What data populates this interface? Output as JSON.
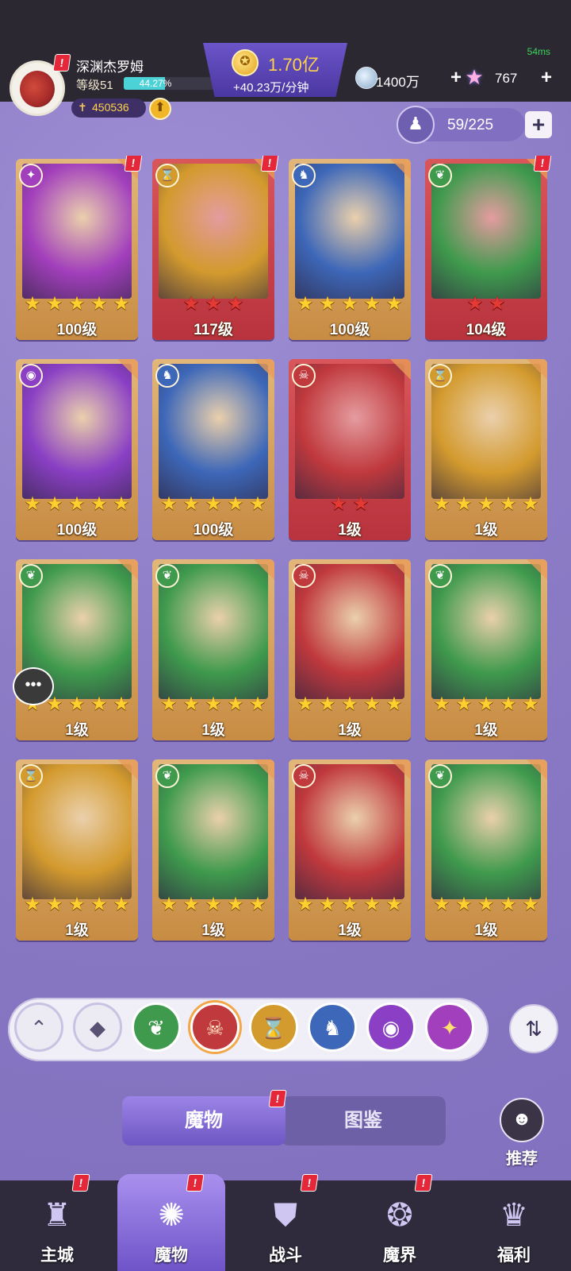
{
  "header": {
    "ping": "54ms",
    "username": "深渊杰罗姆",
    "level": "等级51",
    "exp_percent_text": "44.27%",
    "exp_percent": 44.27,
    "power": "450536",
    "gold_amount": "1.70亿",
    "gold_rate": "+40.23万/分钟",
    "gem_amount": "1400万",
    "star_amount": "767"
  },
  "capacity": {
    "text": "59/225"
  },
  "cards": [
    {
      "level": "100级",
      "stars": 5,
      "star_color": "gold",
      "frame": "gold",
      "element": "swirl",
      "alert": true
    },
    {
      "level": "117级",
      "stars": 3,
      "star_color": "red",
      "frame": "red",
      "element": "hourglass",
      "alert": true
    },
    {
      "level": "100级",
      "stars": 5,
      "star_color": "gold",
      "frame": "gold",
      "element": "dragon",
      "alert": false
    },
    {
      "level": "104级",
      "stars": 2,
      "star_color": "red",
      "frame": "red",
      "element": "leaf",
      "alert": true
    },
    {
      "level": "100级",
      "stars": 5,
      "star_color": "gold",
      "frame": "gold",
      "element": "eye",
      "alert": false
    },
    {
      "level": "100级",
      "stars": 5,
      "star_color": "gold",
      "frame": "gold",
      "element": "dragon",
      "alert": false
    },
    {
      "level": "1级",
      "stars": 2,
      "star_color": "red",
      "frame": "red",
      "element": "demon",
      "alert": false
    },
    {
      "level": "1级",
      "stars": 5,
      "star_color": "gold",
      "frame": "gold",
      "element": "hourglass",
      "alert": false
    },
    {
      "level": "1级",
      "stars": 5,
      "star_color": "gold",
      "frame": "gold",
      "element": "leaf",
      "alert": false
    },
    {
      "level": "1级",
      "stars": 5,
      "star_color": "gold",
      "frame": "gold",
      "element": "leaf",
      "alert": false
    },
    {
      "level": "1级",
      "stars": 5,
      "star_color": "gold",
      "frame": "gold",
      "element": "demon",
      "alert": false
    },
    {
      "level": "1级",
      "stars": 5,
      "star_color": "gold",
      "frame": "gold",
      "element": "leaf",
      "alert": false
    },
    {
      "level": "1级",
      "stars": 5,
      "star_color": "gold",
      "frame": "gold",
      "element": "hourglass",
      "alert": false
    },
    {
      "level": "1级",
      "stars": 5,
      "star_color": "gold",
      "frame": "gold",
      "element": "leaf",
      "alert": false
    },
    {
      "level": "1级",
      "stars": 5,
      "star_color": "gold",
      "frame": "gold",
      "element": "demon",
      "alert": false
    },
    {
      "level": "1级",
      "stars": 5,
      "star_color": "gold",
      "frame": "gold",
      "element": "leaf",
      "alert": false
    }
  ],
  "filters": [
    {
      "name": "collapse-up",
      "icon": "⌃",
      "color": "#eceaf3",
      "text_color": "#5a5275"
    },
    {
      "name": "all",
      "icon": "◆",
      "color": "#eceaf3",
      "text_color": "#5a5275"
    },
    {
      "name": "leaf",
      "icon": "❦",
      "color": "#3f9a4d",
      "text_color": "#ffffff"
    },
    {
      "name": "demon",
      "icon": "☠",
      "color": "#c0393d",
      "text_color": "#ffe7c9"
    },
    {
      "name": "hourglass",
      "icon": "⌛",
      "color": "#d39a2e",
      "text_color": "#ffffff"
    },
    {
      "name": "dragon",
      "icon": "♞",
      "color": "#3d67b8",
      "text_color": "#ffffff"
    },
    {
      "name": "eye",
      "icon": "◉",
      "color": "#8a3fc4",
      "text_color": "#ffffff"
    },
    {
      "name": "swirl",
      "icon": "✦",
      "color": "#a23fbc",
      "text_color": "#ffe070"
    }
  ],
  "tabs": {
    "active": "魔物",
    "inactive": "图鉴"
  },
  "recommend": "推荐",
  "nav": [
    {
      "label": "主城",
      "icon": "♜",
      "alert": true
    },
    {
      "label": "魔物",
      "icon": "✺",
      "alert": true
    },
    {
      "label": "战斗",
      "icon": "⛊",
      "alert": true
    },
    {
      "label": "魔界",
      "icon": "❂",
      "alert": true
    },
    {
      "label": "福利",
      "icon": "♛",
      "alert": false
    }
  ],
  "colors": {
    "leaf": "#3f9a4d",
    "demon": "#c0393d",
    "hourglass": "#d39a2e",
    "dragon": "#3d67b8",
    "eye": "#8a3fc4",
    "swirl": "#a23fbc",
    "accent_gold": "#ffd24a"
  }
}
